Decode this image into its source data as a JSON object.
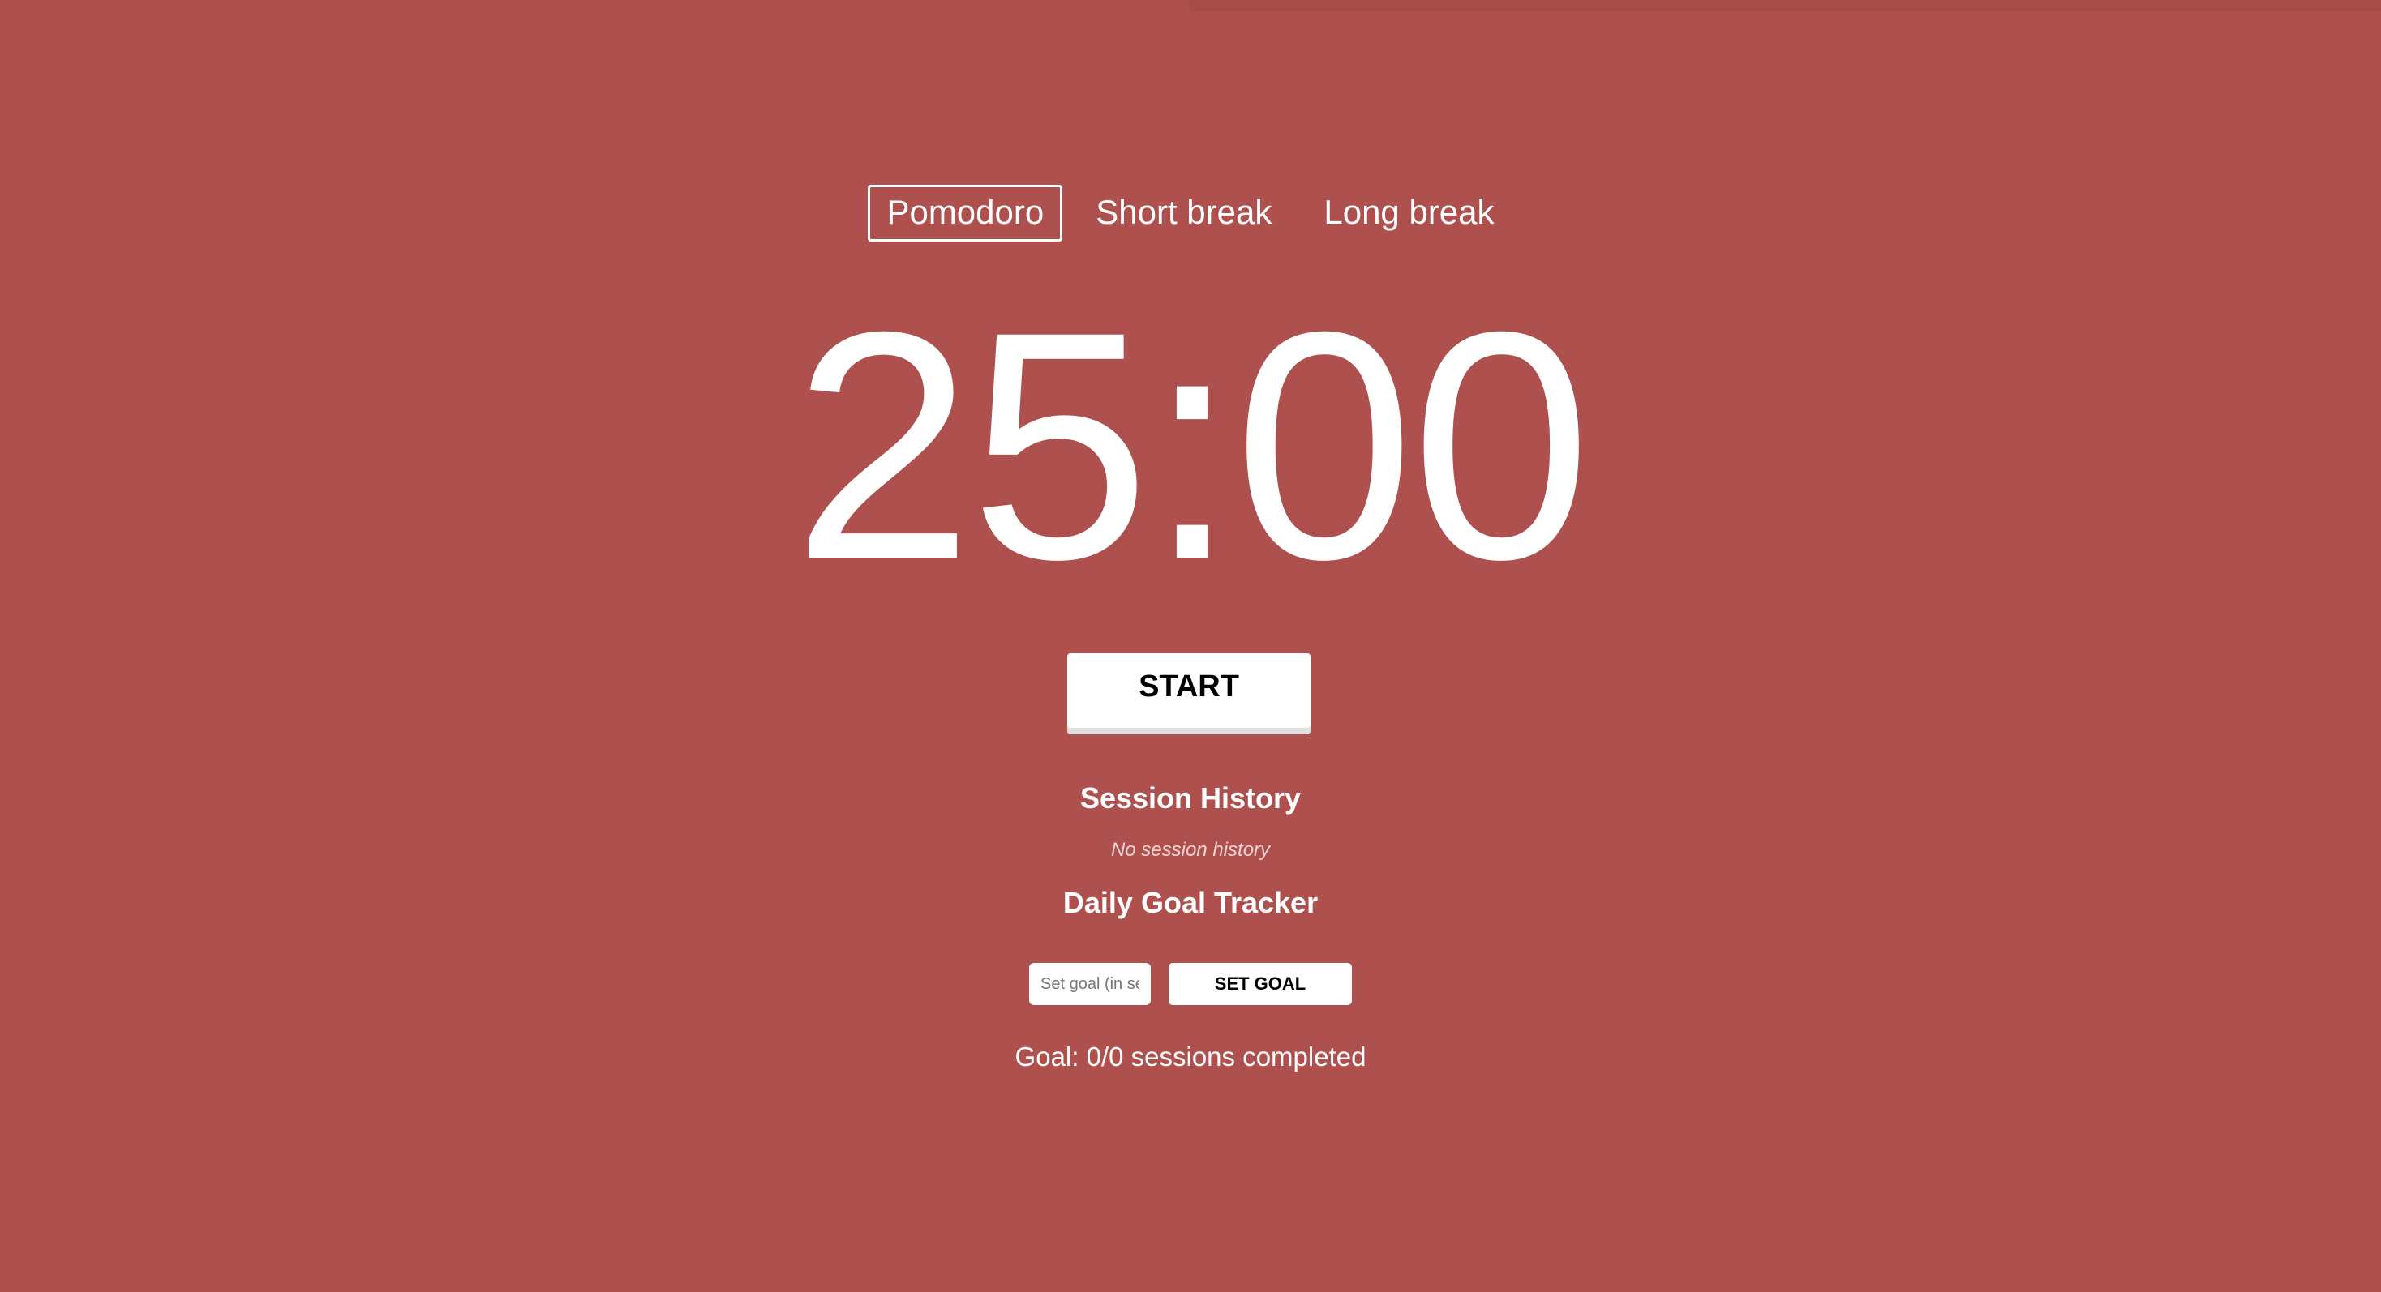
{
  "colors": {
    "background": "#ae514e",
    "text": "#ffffff",
    "button_bg": "#ffffff",
    "button_text": "#000000"
  },
  "tabs": [
    {
      "label": "Pomodoro",
      "active": true
    },
    {
      "label": "Short break",
      "active": false
    },
    {
      "label": "Long break",
      "active": false
    }
  ],
  "timer": {
    "display": "25:00"
  },
  "controls": {
    "start_label": "START"
  },
  "session_history": {
    "title": "Session History",
    "empty_message": "No session history"
  },
  "goal_tracker": {
    "title": "Daily Goal Tracker",
    "input_placeholder": "Set goal (in sessions)",
    "input_value": "",
    "set_button_label": "SET GOAL",
    "status_text": "Goal: 0/0 sessions completed"
  }
}
